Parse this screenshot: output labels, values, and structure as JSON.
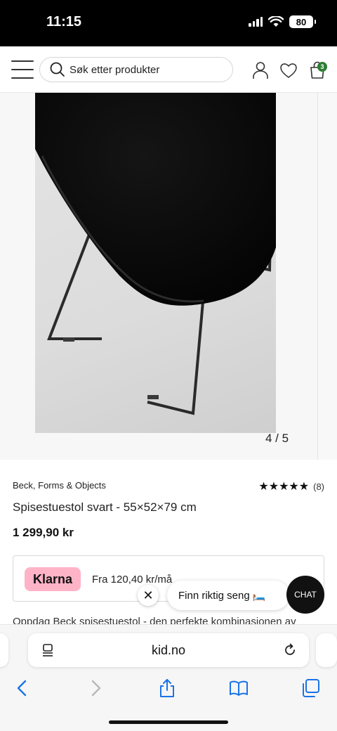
{
  "status_bar": {
    "time": "11:15",
    "battery": "80"
  },
  "header": {
    "search_placeholder": "Søk etter produkter",
    "cart_count": "3",
    "icons": [
      "menu-icon",
      "search-icon",
      "account-icon",
      "heart-icon",
      "cart-icon"
    ]
  },
  "gallery": {
    "counter": "4 / 5"
  },
  "product": {
    "brand": "Beck, Forms & Objects",
    "stars": "★★★★★",
    "rating_count": "(8)",
    "title": "Spisestuestol svart - 55×52×79 cm",
    "price": "1 299,90 kr"
  },
  "klarna": {
    "logo": "Klarna",
    "text": "Fra 120,40 kr/må"
  },
  "description": "Oppdag Beck spisestuestol - den perfekte kombinasjonen av",
  "chat": {
    "close": "✕",
    "prompt": "Finn riktig seng 🛏️",
    "button": "CHAT"
  },
  "browser": {
    "url": "kid.no",
    "icons": [
      "back-icon",
      "forward-icon",
      "share-icon",
      "bookmarks-icon",
      "tabs-icon"
    ]
  },
  "colors": {
    "accent_green": "#2e7d32",
    "klarna_pink": "#ffb3c7",
    "chat_dark": "#111111"
  }
}
